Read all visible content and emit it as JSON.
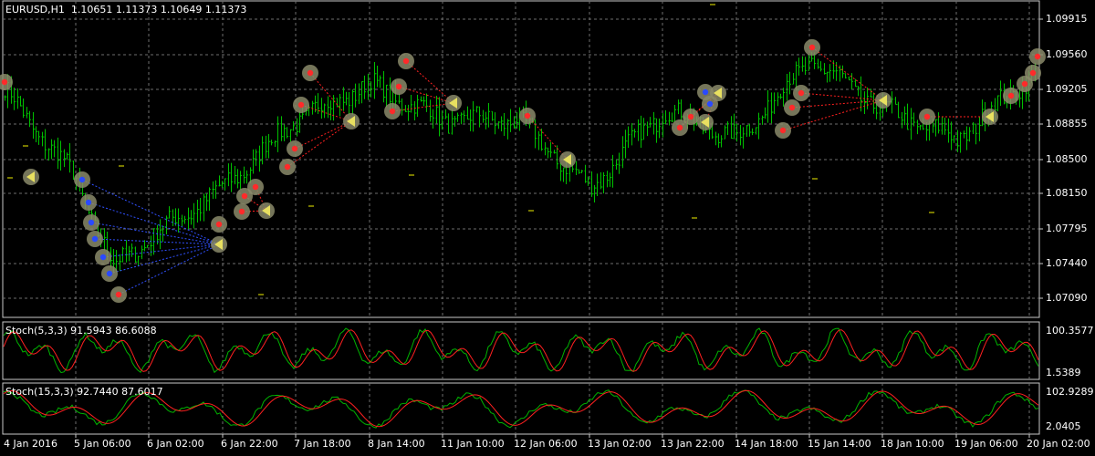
{
  "header": {
    "symbol_timeframe": "EURUSD,H1",
    "ohlc": "1.10651 1.11373 1.10649 1.11373"
  },
  "price_axis": [
    "1.09915",
    "1.09560",
    "1.09205",
    "1.08855",
    "1.08500",
    "1.08150",
    "1.07795",
    "1.07440",
    "1.07090"
  ],
  "time_axis": [
    "4 Jan 2016",
    "5 Jan 06:00",
    "6 Jan 02:00",
    "6 Jan 22:00",
    "7 Jan 18:00",
    "8 Jan 14:00",
    "11 Jan 10:00",
    "12 Jan 06:00",
    "13 Jan 02:00",
    "13 Jan 22:00",
    "14 Jan 18:00",
    "15 Jan 14:00",
    "18 Jan 10:00",
    "19 Jan 06:00",
    "20 Jan 02:00"
  ],
  "indicators": [
    {
      "name": "Stoch(5,3,3)",
      "values": "91.5943 86.6088",
      "max_label": "100.3577",
      "min_label": "1.5389"
    },
    {
      "name": "Stoch(15,3,3)",
      "values": "92.7440 87.6017",
      "max_label": "102.9289",
      "min_label": "2.0405"
    }
  ],
  "colors": {
    "background": "#000000",
    "grid": "#6e6e6e",
    "candle": "#00c000",
    "main_line": "#00b400",
    "signal_line": "#ff2020",
    "marker_fill": "#8a8a6a",
    "marker_red": "#ff2a2a",
    "marker_blue": "#2a4aff",
    "tri_yellow": "#e8e060",
    "link_red": "#ff2020",
    "link_blue": "#3050ff",
    "level_yellow": "#f0f000"
  },
  "chart_data": {
    "type": "candlestick",
    "symbol": "EURUSD",
    "timeframe": "H1",
    "last": {
      "open": 1.10651,
      "high": 1.11373,
      "low": 1.10649,
      "close": 1.11373
    },
    "y_range": [
      1.069,
      1.101
    ],
    "approx_close_path": [
      [
        "4 Jan 2016",
        1.092
      ],
      [
        "5 Jan 06:00",
        1.083
      ],
      [
        "5 Jan 12:00",
        1.074
      ],
      [
        "6 Jan 02:00",
        1.077
      ],
      [
        "6 Jan 22:00",
        1.082
      ],
      [
        "7 Jan 18:00",
        1.089
      ],
      [
        "8 Jan 14:00",
        1.0925
      ],
      [
        "11 Jan 10:00",
        1.089
      ],
      [
        "12 Jan 06:00",
        1.089
      ],
      [
        "13 Jan 02:00",
        1.082
      ],
      [
        "13 Jan 22:00",
        1.09
      ],
      [
        "14 Jan 18:00",
        1.087
      ],
      [
        "15 Jan 14:00",
        1.095
      ],
      [
        "18 Jan 10:00",
        1.09
      ],
      [
        "19 Jan 06:00",
        1.087
      ],
      [
        "20 Jan 02:00",
        1.0935
      ]
    ]
  }
}
